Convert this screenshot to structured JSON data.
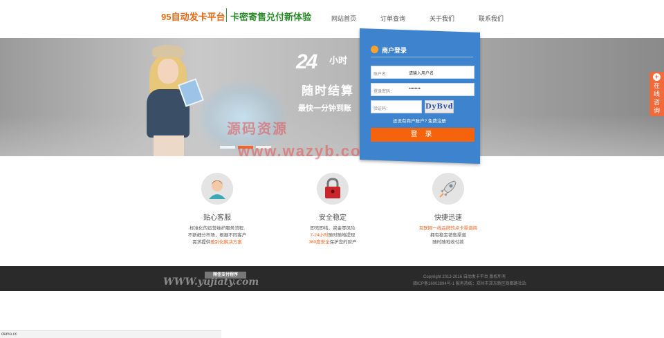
{
  "header": {
    "brand": "95自动发卡平台",
    "slogan": "卡密寄售兑付新体验",
    "nav": [
      "网站首页",
      "订单查询",
      "关于我们",
      "联系我们"
    ]
  },
  "banner": {
    "big": "24",
    "hour": "小时",
    "line1": "随时结算",
    "line2": "最快一分钟到账"
  },
  "login": {
    "title": "商户登录",
    "account_label": "账户名：",
    "account_value": "请输入用户名",
    "password_label": "登录密码：",
    "password_value": "••••••••",
    "captcha_label": "验证码：",
    "captcha_text": "DyBvd",
    "register_text": "还没有商户账户? 免费注册",
    "submit": "登 录"
  },
  "sidetab": {
    "text": "在线咨询"
  },
  "watermark": {
    "line1": "源码资源",
    "line2": "www.wazyb.com"
  },
  "features": [
    {
      "title": "贴心客服",
      "lines": [
        "标准化的运营维护服务流程,",
        "不断细分市场，根据不同客户",
        "需求提供差别化解决方案"
      ]
    },
    {
      "title": "安全稳定",
      "lines": [
        "即充即结，资金零风险",
        "7-24小时随时随地提现",
        "360度安全保护您的财产"
      ]
    },
    {
      "title": "快捷迅速",
      "lines": [
        "互联网一线品牌的点卡渠道商",
        "拥有稳定销售渠道",
        "随时随地收付款"
      ]
    }
  ],
  "footer": {
    "logo_tag": "翔佳支付程序",
    "logo_text": "WWW.yujiaty.com",
    "copyright": "Copyright 2013-2016 自动发卡平台 版权所有",
    "icp": "赣ICP备16002894号-1 服务热线：郑州市郑东新区商都路社站"
  },
  "status_bar": "demo.cc",
  "colors": {
    "accent": "#f26522",
    "login_blue": "#3d83cd",
    "brand_orange": "#e46a16",
    "slogan_green": "#2a8a2a"
  }
}
